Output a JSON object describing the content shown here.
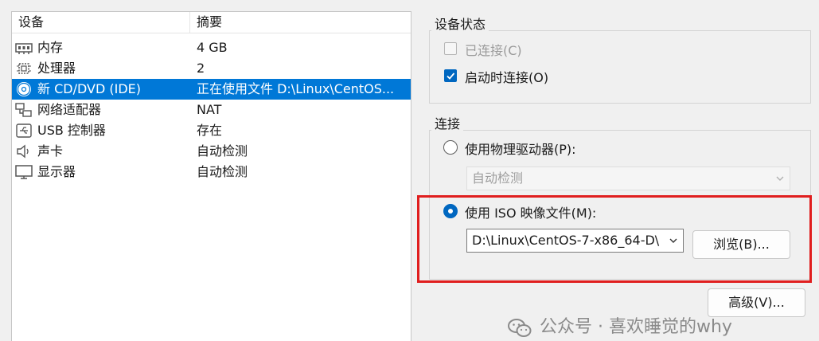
{
  "device_list": {
    "columns": {
      "device": "设备",
      "summary": "摘要"
    },
    "items": [
      {
        "icon": "memory-icon",
        "name": "内存",
        "summary": "4 GB"
      },
      {
        "icon": "processor-icon",
        "name": "处理器",
        "summary": "2"
      },
      {
        "icon": "cd-dvd-icon",
        "name": "新 CD/DVD (IDE)",
        "summary": "正在使用文件 D:\\Linux\\CentOS..."
      },
      {
        "icon": "network-adapter-icon",
        "name": "网络适配器",
        "summary": "NAT"
      },
      {
        "icon": "usb-icon",
        "name": "USB 控制器",
        "summary": "存在"
      },
      {
        "icon": "sound-card-icon",
        "name": "声卡",
        "summary": "自动检测"
      },
      {
        "icon": "display-icon",
        "name": "显示器",
        "summary": "自动检测"
      }
    ],
    "selected_index": 2
  },
  "device_status": {
    "title": "设备状态",
    "connected_label": "已连接(C)",
    "connected_checked": false,
    "connected_enabled": false,
    "connect_on_start_label": "启动时连接(O)",
    "connect_on_start_checked": true
  },
  "connection": {
    "title": "连接",
    "physical_label": "使用物理驱动器(P):",
    "physical_selected": false,
    "physical_drive_value": "自动检测",
    "iso_label": "使用 ISO 映像文件(M):",
    "iso_selected": true,
    "iso_path_value": "D:\\Linux\\CentOS-7-x86_64-D\\",
    "browse_label": "浏览(B)..."
  },
  "advanced_label": "高级(V)...",
  "watermark": {
    "icon": "wechat-icon",
    "text": "公众号 · 喜欢睡觉的why"
  },
  "colors": {
    "selection": "#0078d7",
    "checkbox_accent": "#0067c0",
    "highlight_box": "#e01e1e"
  }
}
